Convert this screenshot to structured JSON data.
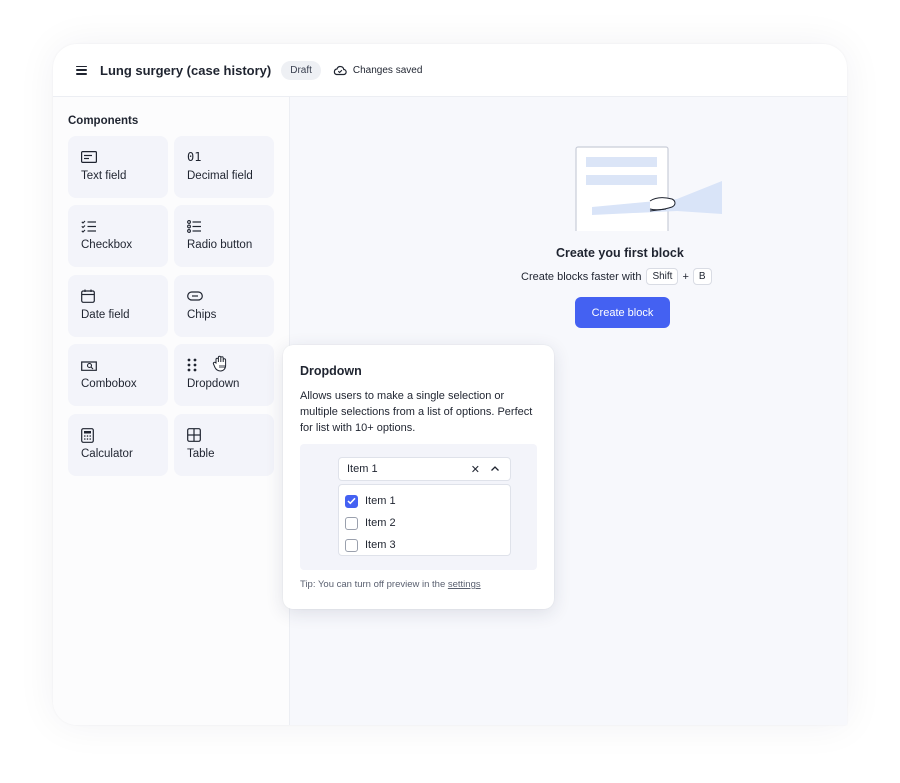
{
  "header": {
    "title": "Lung surgery (case history)",
    "status_badge": "Draft",
    "save_status": "Changes saved"
  },
  "sidebar": {
    "title": "Components",
    "items": [
      {
        "label": "Text field",
        "icon": "text-field-icon"
      },
      {
        "label": "Decimal field",
        "icon": "decimal-icon"
      },
      {
        "label": "Checkbox",
        "icon": "checklist-icon"
      },
      {
        "label": "Radio button",
        "icon": "radio-list-icon"
      },
      {
        "label": "Date field",
        "icon": "calendar-icon"
      },
      {
        "label": "Chips",
        "icon": "chip-icon"
      },
      {
        "label": "Combobox",
        "icon": "combobox-icon"
      },
      {
        "label": "Dropdown",
        "icon": "drag-handle-icon"
      },
      {
        "label": "Calculator",
        "icon": "calculator-icon"
      },
      {
        "label": "Table",
        "icon": "table-icon"
      }
    ],
    "decimal_icon_text": "01"
  },
  "empty_state": {
    "title": "Create you first block",
    "hint_prefix": "Create blocks faster with",
    "shortcut_key_1": "Shift",
    "shortcut_plus": "+",
    "shortcut_key_2": "B",
    "button_label": "Create block"
  },
  "popover": {
    "title": "Dropdown",
    "description": "Allows users to make a single selection or multiple selections from a list of options. Perfect for list with 10+ options.",
    "preview": {
      "selected_value": "Item 1",
      "options": [
        {
          "label": "Item 1",
          "checked": true
        },
        {
          "label": "Item 2",
          "checked": false
        },
        {
          "label": "Item 3",
          "checked": false
        }
      ]
    },
    "tip_prefix": "Tip: You can turn off preview in the",
    "tip_link": "settings"
  },
  "colors": {
    "accent": "#4461f2",
    "tile_bg": "#f3f4fa",
    "canvas_bg": "#f7f8fc"
  }
}
